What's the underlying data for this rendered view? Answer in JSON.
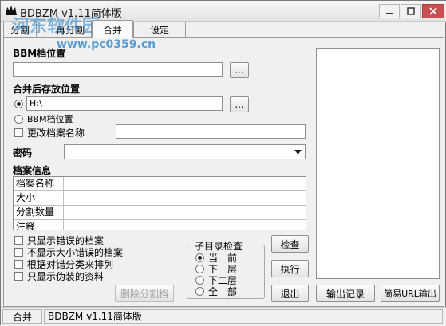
{
  "window": {
    "title": "BDBZM v1.11简体版",
    "controls": [
      "minimize-icon",
      "maximize-icon",
      "close-icon"
    ]
  },
  "watermark": {
    "line1": "河东软件园",
    "line2": "www.pc0359.cn"
  },
  "tabs": [
    {
      "label": "分割",
      "active": false
    },
    {
      "label": "再分割",
      "active": false
    },
    {
      "label": "合并",
      "active": true
    },
    {
      "label": "设定",
      "active": false
    }
  ],
  "form": {
    "bbm_location_label": "BBM档位置",
    "bbm_location_value": "",
    "browse_label": "...",
    "merge_save_label": "合并后存放位置",
    "save_option1_value": "H:\\",
    "save_option2_label": "BBM档位置",
    "rename_label": "更改档案名称",
    "rename_value": "",
    "password_label": "密码",
    "password_value": "",
    "file_info_label": "档案信息",
    "info_rows": [
      "档案名称",
      "大小",
      "分割数量",
      "注释"
    ]
  },
  "options": {
    "only_errors": "只显示错误的档案",
    "hide_size_errors": "不显示大小错误的档案",
    "sort_by_error": "根据对错分类来排列",
    "only_fakes": "只显示伪装的资料"
  },
  "buttons": {
    "delete_parts": "删除分割档",
    "check": "检查",
    "execute": "执行",
    "exit": "退出",
    "export_log": "输出记录",
    "export_url": "简易URL输出"
  },
  "subdir": {
    "title": "子目录检查",
    "options": [
      "当　前",
      "下一层",
      "下二层",
      "全　部"
    ],
    "selected": "当　前"
  },
  "status": {
    "mode": "合并",
    "version": "BDBZM v1.11简体版"
  }
}
